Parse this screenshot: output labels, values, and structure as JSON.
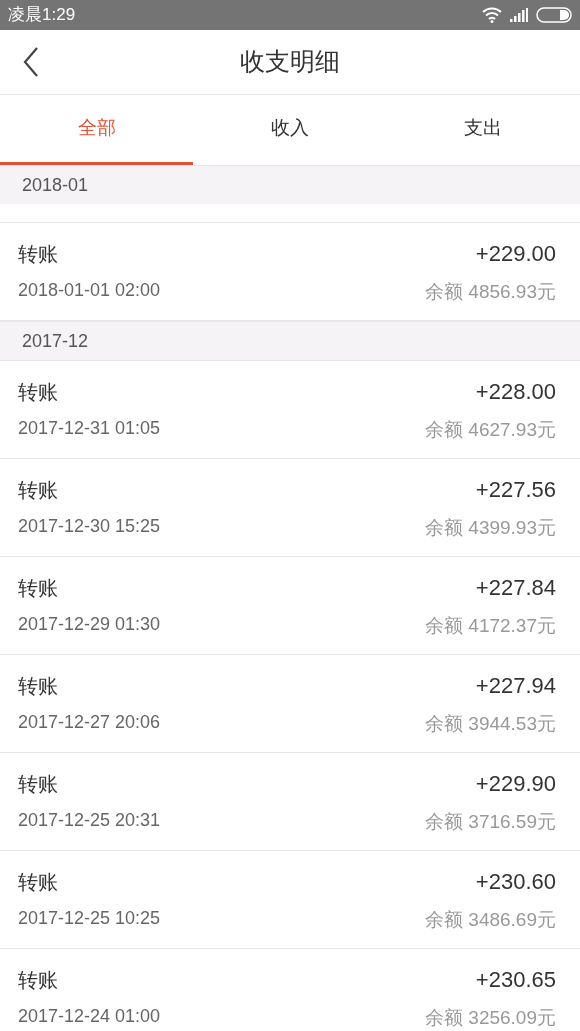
{
  "status_bar": {
    "time": "凌晨1:29"
  },
  "header": {
    "title": "收支明细"
  },
  "tabs": [
    {
      "label": "全部",
      "selected": true
    },
    {
      "label": "收入",
      "selected": false
    },
    {
      "label": "支出",
      "selected": false
    }
  ],
  "sections": [
    {
      "month": "2018-01",
      "partial_row_above": true,
      "rows": [
        {
          "name": "转账",
          "time": "2018-01-01 02:00",
          "amount": "+229.00",
          "balance": "余额 4856.93元"
        }
      ]
    },
    {
      "month": "2017-12",
      "partial_row_above": false,
      "rows": [
        {
          "name": "转账",
          "time": "2017-12-31 01:05",
          "amount": "+228.00",
          "balance": "余额 4627.93元"
        },
        {
          "name": "转账",
          "time": "2017-12-30 15:25",
          "amount": "+227.56",
          "balance": "余额 4399.93元"
        },
        {
          "name": "转账",
          "time": "2017-12-29 01:30",
          "amount": "+227.84",
          "balance": "余额 4172.37元"
        },
        {
          "name": "转账",
          "time": "2017-12-27 20:06",
          "amount": "+227.94",
          "balance": "余额 3944.53元"
        },
        {
          "name": "转账",
          "time": "2017-12-25 20:31",
          "amount": "+229.90",
          "balance": "余额 3716.59元"
        },
        {
          "name": "转账",
          "time": "2017-12-25 10:25",
          "amount": "+230.60",
          "balance": "余额 3486.69元"
        },
        {
          "name": "转账",
          "time": "2017-12-24 01:00",
          "amount": "+230.65",
          "balance": "余额 3256.09元"
        }
      ]
    }
  ]
}
